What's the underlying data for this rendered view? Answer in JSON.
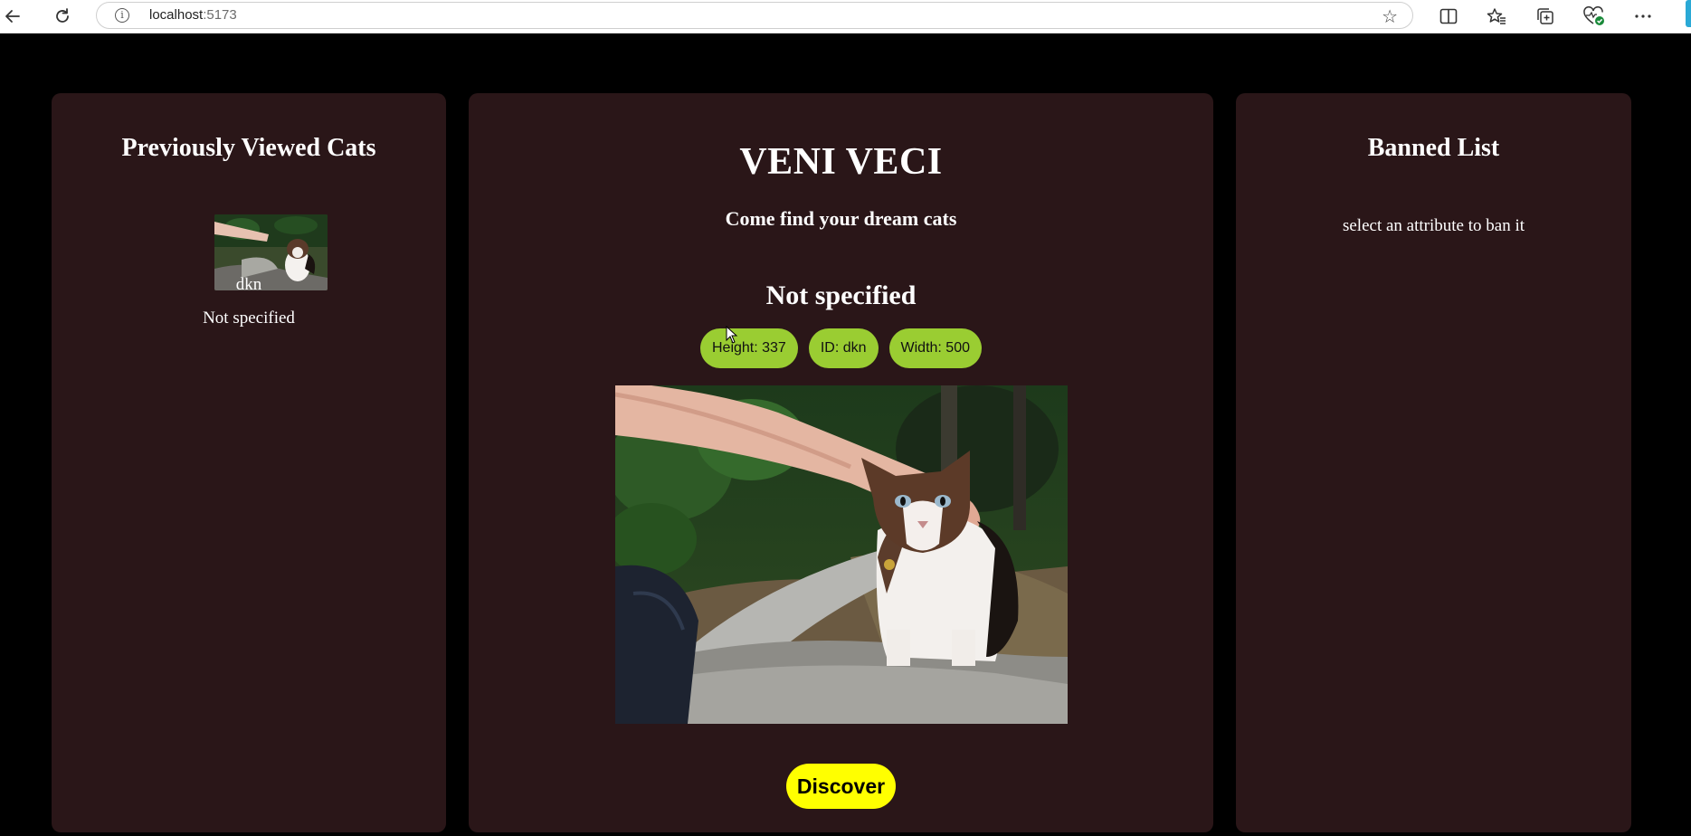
{
  "browser": {
    "url_host": "localhost",
    "url_port": ":5173",
    "nav": {
      "back_icon": "back-arrow-icon",
      "reload_icon": "reload-icon"
    },
    "toolbar_icons": [
      "split-screen-icon",
      "favorites-icon",
      "collections-icon",
      "browser-essentials-icon",
      "more-options-icon"
    ]
  },
  "history": {
    "title": "Previously Viewed Cats",
    "items": [
      {
        "id": "dkn",
        "breed": "Not specified"
      }
    ]
  },
  "main": {
    "title": "VENI VECI",
    "subtitle": "Come find your dream cats",
    "breed": "Not specified",
    "attributes": [
      {
        "label": "Height: 337"
      },
      {
        "label": "ID: dkn"
      },
      {
        "label": "Width: 500"
      }
    ],
    "discover_label": "Discover"
  },
  "banned": {
    "title": "Banned List",
    "hint": "select an attribute to ban it"
  },
  "colors": {
    "page_background": "#000000",
    "panel_background": "#2a1618",
    "attribute_button": "#9acd32",
    "discover_button": "#ffff00",
    "text": "#ffffff"
  }
}
